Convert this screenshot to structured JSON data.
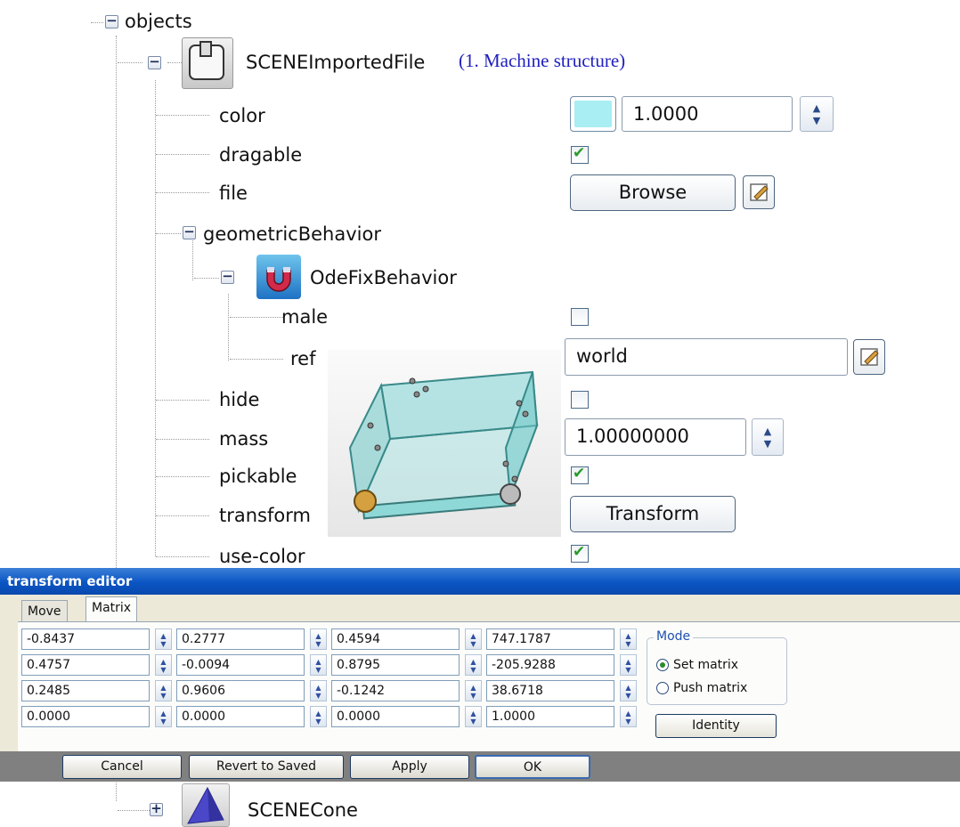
{
  "tree": {
    "objects_label": "objects",
    "imported_file_label": "SCENEImportedFile",
    "imported_file_caption": "(1. Machine structure)",
    "props": {
      "color": "color",
      "dragable": "dragable",
      "file": "file",
      "geometric_behavior": "geometricBehavior",
      "ode_fix_behavior": "OdeFixBehavior",
      "male": "male",
      "ref": "ref",
      "hide": "hide",
      "mass": "mass",
      "pickable": "pickable",
      "transform": "transform",
      "use_color": "use-color"
    },
    "values": {
      "color_value": "1.0000",
      "color_swatch": "#a8eef2",
      "dragable_checked": true,
      "browse_label": "Browse",
      "male_checked": false,
      "ref_value": "world",
      "hide_checked": false,
      "mass_value": "1.00000000",
      "pickable_checked": true,
      "transform_button": "Transform",
      "use_color_checked": true
    },
    "cone_label": "SCENECone"
  },
  "editor": {
    "title": "transform editor",
    "tabs": [
      "Move",
      "Matrix"
    ],
    "active_tab": "Matrix",
    "matrix": [
      [
        "-0.8437",
        "0.2777",
        "0.4594",
        "747.1787"
      ],
      [
        "0.4757",
        "-0.0094",
        "0.8795",
        "-205.9288"
      ],
      [
        "0.2485",
        "0.9606",
        "-0.1242",
        "38.6718"
      ],
      [
        "0.0000",
        "0.0000",
        "0.0000",
        "1.0000"
      ]
    ],
    "mode_label": "Mode",
    "set_matrix": "Set matrix",
    "push_matrix": "Push matrix",
    "identity": "Identity",
    "buttons": {
      "cancel": "Cancel",
      "revert": "Revert to Saved",
      "apply": "Apply",
      "ok": "OK"
    }
  }
}
